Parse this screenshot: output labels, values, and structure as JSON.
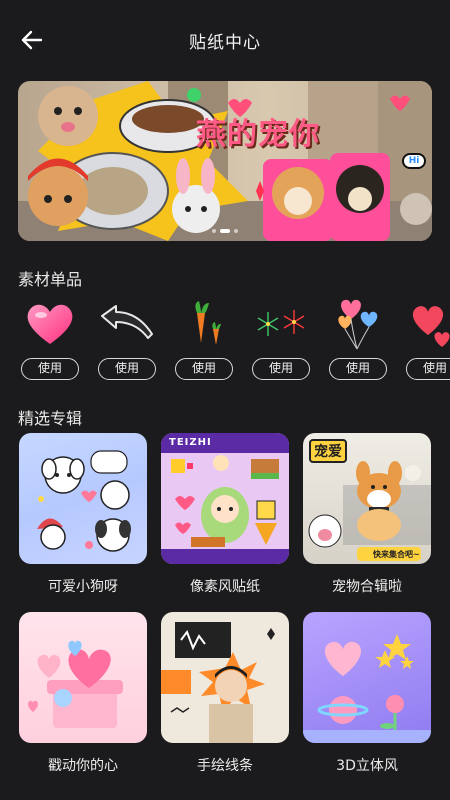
{
  "header": {
    "title": "贴纸中心",
    "back_icon": "back-arrow-icon"
  },
  "banner": {
    "title": "燕的宠你",
    "bubble_text": "Hi",
    "pages": 3,
    "active_page": 1
  },
  "sections": {
    "materials_title": "素材单品",
    "albums_title": "精选专辑"
  },
  "stickers": [
    {
      "icon": "heart-sticker-icon",
      "use_label": "使用"
    },
    {
      "icon": "curved-arrow-sticker-icon",
      "use_label": "使用"
    },
    {
      "icon": "carrot-sticker-icon",
      "use_label": "使用"
    },
    {
      "icon": "fireworks-sticker-icon",
      "use_label": "使用"
    },
    {
      "icon": "heart-balloons-sticker-icon",
      "use_label": "使用"
    },
    {
      "icon": "red-hearts-sticker-icon",
      "use_label": "使用"
    }
  ],
  "albums": [
    {
      "title": "可爱小狗呀",
      "thumb": "cute-puppies-thumb"
    },
    {
      "title": "像素风贴纸",
      "thumb": "pixel-stickers-thumb",
      "thumb_text": "TEIZHI"
    },
    {
      "title": "宠物合辑啦",
      "thumb": "pet-collection-thumb",
      "thumb_text": "宠爱",
      "thumb_caption": "快来集合吧~"
    },
    {
      "title": "戳动你的心",
      "thumb": "pink-hearts-thumb"
    },
    {
      "title": "手绘线条",
      "thumb": "hand-drawn-thumb"
    },
    {
      "title": "3D立体风",
      "thumb": "3d-style-thumb"
    }
  ],
  "colors": {
    "background": "#1b1b1d",
    "text": "#ffffff",
    "banner_title": "#ff5a86"
  }
}
